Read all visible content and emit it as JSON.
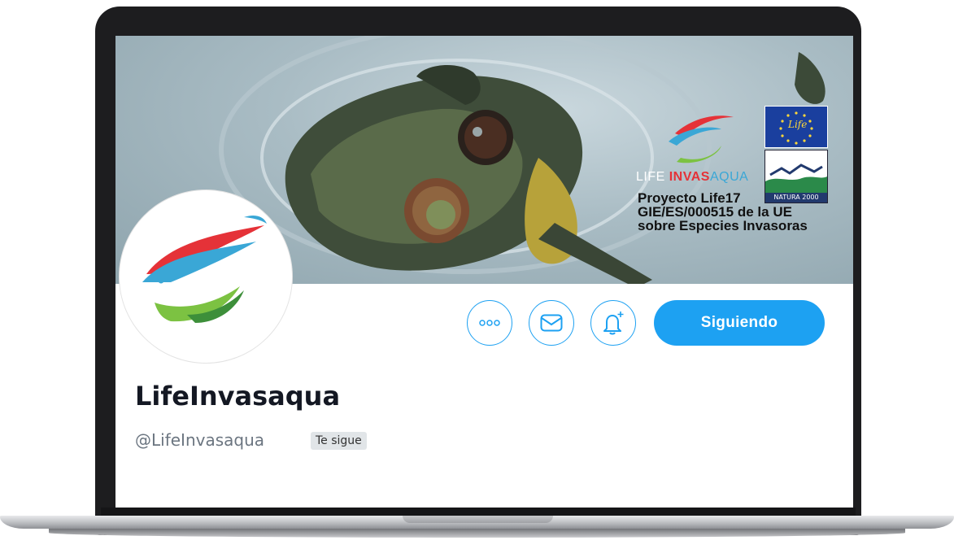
{
  "banner": {
    "brand_prefix": "LIFE ",
    "brand_accent": "INVAS",
    "brand_accent2": "AQUA",
    "project_lines": [
      "Proyecto Life17",
      "GIE/ES/000515 de la UE",
      "sobre Especies Invasoras"
    ],
    "eu_flag_text": "Life",
    "natura_label": "NATURA 2000"
  },
  "profile": {
    "display_name": "LifeInvasaqua",
    "handle": "@LifeInvasaqua",
    "follows_you_badge": "Te sigue"
  },
  "actions": {
    "more_icon": "more-dots-icon",
    "message_icon": "envelope-icon",
    "notify_icon": "bell-plus-icon",
    "follow_label": "Siguiendo"
  },
  "colors": {
    "accent": "#1da1f2",
    "logo_red": "#e53238",
    "logo_blue": "#3aa7d6",
    "logo_green": "#7cc242"
  }
}
